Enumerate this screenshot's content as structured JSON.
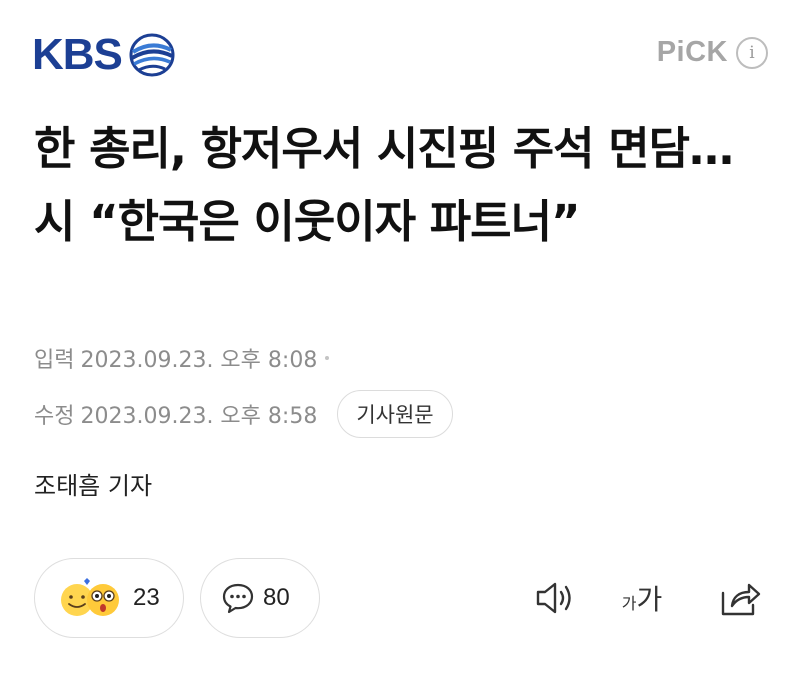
{
  "header": {
    "brand": "KBS",
    "pick_label": "PiCK",
    "info_label": "i"
  },
  "article": {
    "headline": "한 총리, 항저우서 시진핑 주석 면담…시 “한국은 이웃이자 파트너”",
    "input_label": "입력",
    "input_time": "2023.09.23. 오후 8:08",
    "edit_label": "수정",
    "edit_time": "2023.09.23. 오후 8:58",
    "original_button": "기사원문",
    "reporter": "조태흠 기자"
  },
  "actions": {
    "reaction_count": "23",
    "comment_count": "80",
    "font_small": "가",
    "font_big": "가"
  },
  "icons": {
    "brand_logo": "kbs-globe-logo",
    "info": "info-icon",
    "reaction": "smile-surprise-emoji-icon",
    "comment": "speech-bubble-icon",
    "speaker": "speaker-icon",
    "font_size": "font-size-icon",
    "share": "share-icon"
  },
  "colors": {
    "brand": "#1c3f94",
    "muted": "#8c8c8c",
    "pick": "#a6a6a6"
  }
}
